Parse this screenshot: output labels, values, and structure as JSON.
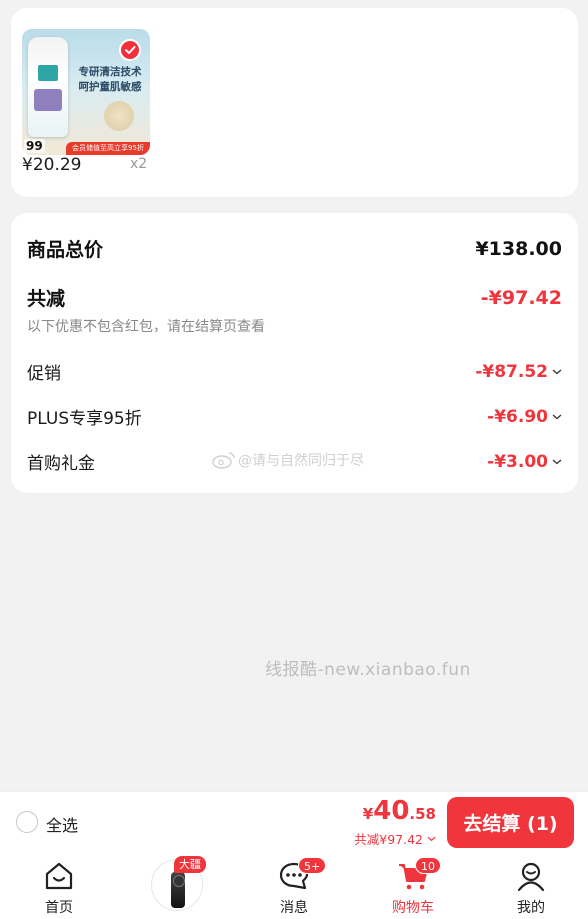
{
  "product": {
    "thumb_headline_1": "专研清洁技术",
    "thumb_headline_2": "呵护童肌敏感",
    "thumb_price": "99",
    "thumb_badge": "会员储值至高立享95折",
    "price": "¥20.29",
    "quantity": "x2",
    "selected": true
  },
  "summary": {
    "goods_total_label": "商品总价",
    "goods_total_value": "¥138.00",
    "total_reduce_label": "共减",
    "total_reduce_value": "-¥97.42",
    "note": "以下优惠不包含红包，请在结算页查看",
    "items": [
      {
        "label": "促销",
        "value": "-¥87.52"
      },
      {
        "label": "PLUS专享95折",
        "value": "-¥6.90"
      },
      {
        "label": "首购礼金",
        "value": "-¥3.00"
      }
    ]
  },
  "watermarks": {
    "weibo": "@请与自然同归于尽",
    "site": "线报酷-new.xianbao.fun"
  },
  "checkout": {
    "select_all_label": "全选",
    "price_currency": "¥",
    "price_int": "40",
    "price_dec": ".58",
    "saved_label": "共减¥97.42",
    "button_label": "去结算 (1)"
  },
  "tabbar": {
    "home_label": "首页",
    "promo_tag": "大疆",
    "messages_label": "消息",
    "messages_badge": "5+",
    "cart_label": "购物车",
    "cart_badge": "10",
    "mine_label": "我的"
  },
  "colors": {
    "accent": "#f0353c",
    "background": "#f2f2f2",
    "muted_text": "#888888"
  },
  "icons": [
    "check-icon",
    "chevron-down-icon",
    "weibo-icon",
    "home-icon",
    "message-icon",
    "cart-icon",
    "user-icon"
  ]
}
